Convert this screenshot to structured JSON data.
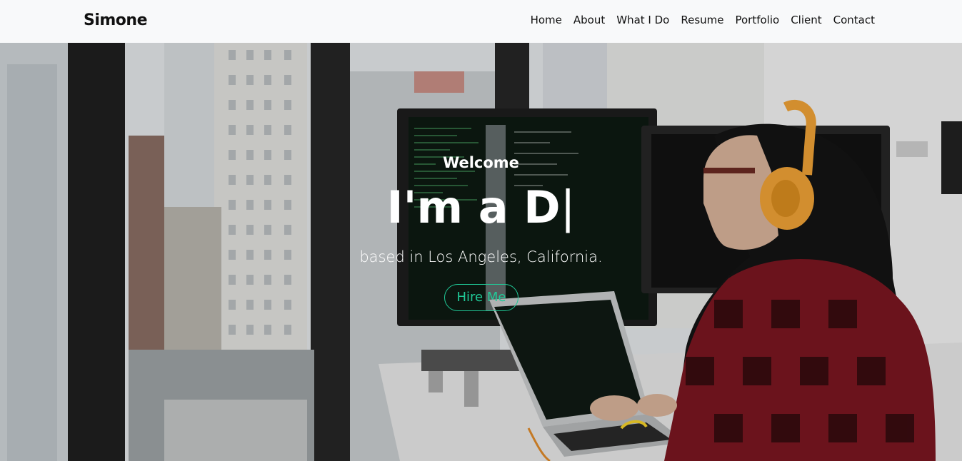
{
  "brand": "Simone",
  "nav": {
    "items": [
      "Home",
      "About",
      "What I Do",
      "Resume",
      "Portfolio",
      "Client",
      "Contact"
    ]
  },
  "hero": {
    "welcome": "Welcome",
    "headline": "I'm a D",
    "cursor": "|",
    "subline": "based in Los Angeles, California.",
    "button": "Hire Me"
  },
  "colors": {
    "navbar_bg": "#f8f9fa",
    "accent": "#20c997",
    "text_dark": "#111111"
  }
}
